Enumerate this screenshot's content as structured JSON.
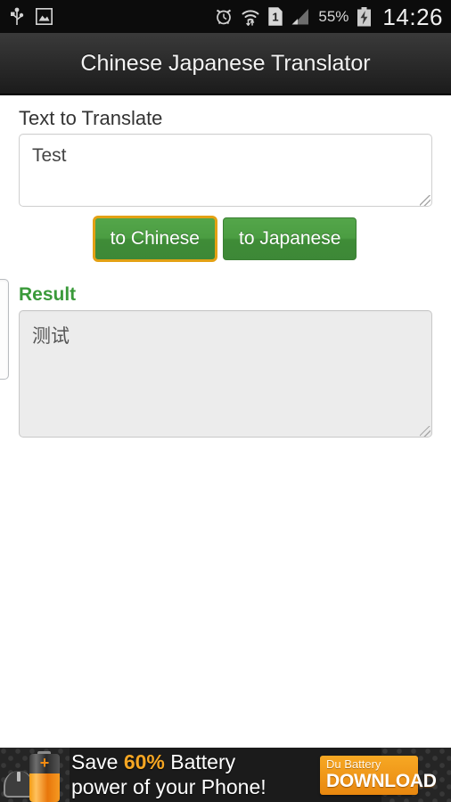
{
  "status_bar": {
    "left_icons": [
      "usb-icon",
      "screenshot-icon"
    ],
    "right_icons": [
      "alarm-icon",
      "wifi-icon",
      "sim-card-icon",
      "signal-icon",
      "battery-icon"
    ],
    "sim_label": "1",
    "battery_percent": "55%",
    "clock": "14:26"
  },
  "title_bar": {
    "title": "Chinese Japanese Translator"
  },
  "form": {
    "input_label": "Text to Translate",
    "input_value": "Test",
    "input_placeholder": "",
    "result_label": "Result",
    "result_value": "测试",
    "result_placeholder": "",
    "buttons": [
      {
        "label": "to Chinese",
        "name": "to-chinese-button",
        "focused": true
      },
      {
        "label": "to Japanese",
        "name": "to-japanese-button",
        "focused": false
      }
    ]
  },
  "ad": {
    "line1_prefix": "Save ",
    "line1_highlight": "60%",
    "line1_suffix": " Battery",
    "line2": "power of your Phone!",
    "cta_top": "Du Battery",
    "cta_main": "DOWNLOAD"
  },
  "colors": {
    "accent_green": "#3a9a3a",
    "button_green": "#4b9d42",
    "focus_orange": "#e3a114",
    "ad_orange": "#f5a623",
    "title_bar": "#2c2c2c",
    "status_bar": "#0c0c0c"
  }
}
